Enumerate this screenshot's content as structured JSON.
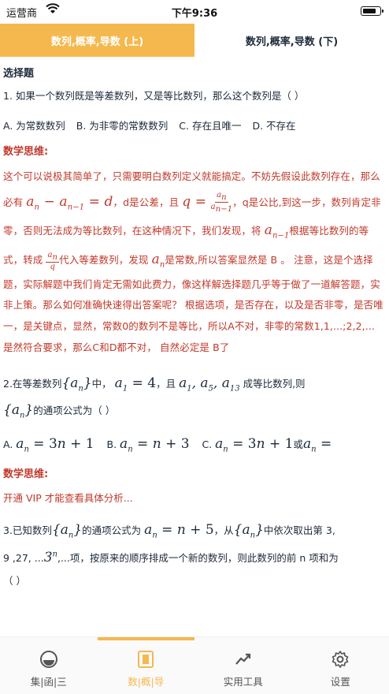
{
  "status": {
    "carrier": "运营商",
    "time": "下午9:36"
  },
  "top_tabs": [
    {
      "label": "数列,概率,导数 (上)",
      "active": true
    },
    {
      "label": "数列,概率,导数 (下)",
      "active": false
    }
  ],
  "section_title": "选择题",
  "q1": {
    "text": "1.  如果一个数列既是等差数列，又是等比数列，那么这个数列是（        ）",
    "options": [
      "A.  为常数数列",
      "B. 为非零的常数数列",
      "C. 存在且唯一",
      "D. 不存在"
    ],
    "analysis_title": "数学思维:",
    "a1": "这个可以说极其简单了，只需要明白数列定义就能搞定。不妨先假设此数列存在，那么必有",
    "a2": "，d是公差，且",
    "a3": "，q是公比,到这一步，数列肯定非零，否则无法成为等比数列，在这种情况下，我们发现，将",
    "a4": "根据等比数列的等式，转成",
    "a5": "代入等差数列，发现",
    "a6": "是常数,所以答案显然是 B 。 注意，这是个选择题，实际解题中我们肯定无需如此费力，像这样解选择题几乎等于做了一道解答题，实非上策。那么如何准确快速得出答案呢？ 根据选项，是否存在，以及是否非零，是否唯一，是关键点，显然，常数0的数列不是等比，所以A不对，非零的常数1,1,...;2,2,...是然符合要求，那么C和D都不对， 自然必定是 B了"
  },
  "q2": {
    "t1": "2.在等差数列",
    "t2": "中，",
    "t3": "，且",
    "t4": "成等比数列,则",
    "t5": "的通项公式为（        ）",
    "opt_a": "A.",
    "opt_b": "B.",
    "opt_c": "C.",
    "or_text": "或",
    "analysis_title": "数学思维:",
    "vip": "开通 VIP 才能查看具体分析..."
  },
  "q3": {
    "t1": "3.已知数列",
    "t2": "的通项公式为",
    "t3": "，从",
    "t4": "中依次取出第 3,",
    "t5": "9 ,27, ...",
    "t6": ",...项，按原来的顺序排成一个新的数列，则此数列的前 n 项和为",
    "t7": "（        ）"
  },
  "tab_bar": [
    {
      "label": "集|函|三",
      "icon": "circle-icon",
      "active": false
    },
    {
      "label": "数|概|导",
      "icon": "book-icon",
      "active": true
    },
    {
      "label": "实用工具",
      "icon": "trend-icon",
      "active": false
    },
    {
      "label": "设置",
      "icon": "gear-icon",
      "active": false
    }
  ],
  "colors": {
    "accent": "#f5b84f",
    "analysis": "#c0392b",
    "text": "#1c2a3a"
  }
}
